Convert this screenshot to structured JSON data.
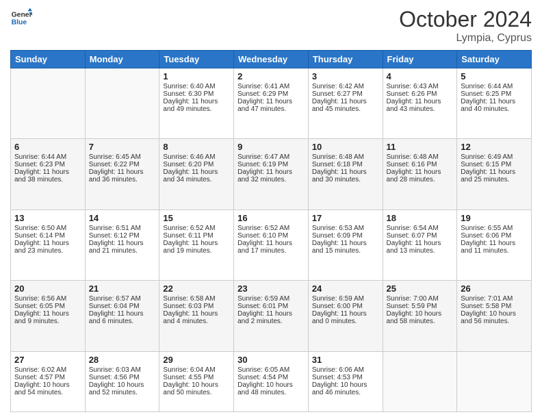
{
  "logo": {
    "line1": "General",
    "line2": "Blue"
  },
  "header": {
    "month": "October 2024",
    "location": "Lympia, Cyprus"
  },
  "weekdays": [
    "Sunday",
    "Monday",
    "Tuesday",
    "Wednesday",
    "Thursday",
    "Friday",
    "Saturday"
  ],
  "weeks": [
    [
      {
        "day": "",
        "sunrise": "",
        "sunset": "",
        "daylight": ""
      },
      {
        "day": "",
        "sunrise": "",
        "sunset": "",
        "daylight": ""
      },
      {
        "day": "1",
        "sunrise": "Sunrise: 6:40 AM",
        "sunset": "Sunset: 6:30 PM",
        "daylight": "Daylight: 11 hours and 49 minutes."
      },
      {
        "day": "2",
        "sunrise": "Sunrise: 6:41 AM",
        "sunset": "Sunset: 6:29 PM",
        "daylight": "Daylight: 11 hours and 47 minutes."
      },
      {
        "day": "3",
        "sunrise": "Sunrise: 6:42 AM",
        "sunset": "Sunset: 6:27 PM",
        "daylight": "Daylight: 11 hours and 45 minutes."
      },
      {
        "day": "4",
        "sunrise": "Sunrise: 6:43 AM",
        "sunset": "Sunset: 6:26 PM",
        "daylight": "Daylight: 11 hours and 43 minutes."
      },
      {
        "day": "5",
        "sunrise": "Sunrise: 6:44 AM",
        "sunset": "Sunset: 6:25 PM",
        "daylight": "Daylight: 11 hours and 40 minutes."
      }
    ],
    [
      {
        "day": "6",
        "sunrise": "Sunrise: 6:44 AM",
        "sunset": "Sunset: 6:23 PM",
        "daylight": "Daylight: 11 hours and 38 minutes."
      },
      {
        "day": "7",
        "sunrise": "Sunrise: 6:45 AM",
        "sunset": "Sunset: 6:22 PM",
        "daylight": "Daylight: 11 hours and 36 minutes."
      },
      {
        "day": "8",
        "sunrise": "Sunrise: 6:46 AM",
        "sunset": "Sunset: 6:20 PM",
        "daylight": "Daylight: 11 hours and 34 minutes."
      },
      {
        "day": "9",
        "sunrise": "Sunrise: 6:47 AM",
        "sunset": "Sunset: 6:19 PM",
        "daylight": "Daylight: 11 hours and 32 minutes."
      },
      {
        "day": "10",
        "sunrise": "Sunrise: 6:48 AM",
        "sunset": "Sunset: 6:18 PM",
        "daylight": "Daylight: 11 hours and 30 minutes."
      },
      {
        "day": "11",
        "sunrise": "Sunrise: 6:48 AM",
        "sunset": "Sunset: 6:16 PM",
        "daylight": "Daylight: 11 hours and 28 minutes."
      },
      {
        "day": "12",
        "sunrise": "Sunrise: 6:49 AM",
        "sunset": "Sunset: 6:15 PM",
        "daylight": "Daylight: 11 hours and 25 minutes."
      }
    ],
    [
      {
        "day": "13",
        "sunrise": "Sunrise: 6:50 AM",
        "sunset": "Sunset: 6:14 PM",
        "daylight": "Daylight: 11 hours and 23 minutes."
      },
      {
        "day": "14",
        "sunrise": "Sunrise: 6:51 AM",
        "sunset": "Sunset: 6:12 PM",
        "daylight": "Daylight: 11 hours and 21 minutes."
      },
      {
        "day": "15",
        "sunrise": "Sunrise: 6:52 AM",
        "sunset": "Sunset: 6:11 PM",
        "daylight": "Daylight: 11 hours and 19 minutes."
      },
      {
        "day": "16",
        "sunrise": "Sunrise: 6:52 AM",
        "sunset": "Sunset: 6:10 PM",
        "daylight": "Daylight: 11 hours and 17 minutes."
      },
      {
        "day": "17",
        "sunrise": "Sunrise: 6:53 AM",
        "sunset": "Sunset: 6:09 PM",
        "daylight": "Daylight: 11 hours and 15 minutes."
      },
      {
        "day": "18",
        "sunrise": "Sunrise: 6:54 AM",
        "sunset": "Sunset: 6:07 PM",
        "daylight": "Daylight: 11 hours and 13 minutes."
      },
      {
        "day": "19",
        "sunrise": "Sunrise: 6:55 AM",
        "sunset": "Sunset: 6:06 PM",
        "daylight": "Daylight: 11 hours and 11 minutes."
      }
    ],
    [
      {
        "day": "20",
        "sunrise": "Sunrise: 6:56 AM",
        "sunset": "Sunset: 6:05 PM",
        "daylight": "Daylight: 11 hours and 9 minutes."
      },
      {
        "day": "21",
        "sunrise": "Sunrise: 6:57 AM",
        "sunset": "Sunset: 6:04 PM",
        "daylight": "Daylight: 11 hours and 6 minutes."
      },
      {
        "day": "22",
        "sunrise": "Sunrise: 6:58 AM",
        "sunset": "Sunset: 6:03 PM",
        "daylight": "Daylight: 11 hours and 4 minutes."
      },
      {
        "day": "23",
        "sunrise": "Sunrise: 6:59 AM",
        "sunset": "Sunset: 6:01 PM",
        "daylight": "Daylight: 11 hours and 2 minutes."
      },
      {
        "day": "24",
        "sunrise": "Sunrise: 6:59 AM",
        "sunset": "Sunset: 6:00 PM",
        "daylight": "Daylight: 11 hours and 0 minutes."
      },
      {
        "day": "25",
        "sunrise": "Sunrise: 7:00 AM",
        "sunset": "Sunset: 5:59 PM",
        "daylight": "Daylight: 10 hours and 58 minutes."
      },
      {
        "day": "26",
        "sunrise": "Sunrise: 7:01 AM",
        "sunset": "Sunset: 5:58 PM",
        "daylight": "Daylight: 10 hours and 56 minutes."
      }
    ],
    [
      {
        "day": "27",
        "sunrise": "Sunrise: 6:02 AM",
        "sunset": "Sunset: 4:57 PM",
        "daylight": "Daylight: 10 hours and 54 minutes."
      },
      {
        "day": "28",
        "sunrise": "Sunrise: 6:03 AM",
        "sunset": "Sunset: 4:56 PM",
        "daylight": "Daylight: 10 hours and 52 minutes."
      },
      {
        "day": "29",
        "sunrise": "Sunrise: 6:04 AM",
        "sunset": "Sunset: 4:55 PM",
        "daylight": "Daylight: 10 hours and 50 minutes."
      },
      {
        "day": "30",
        "sunrise": "Sunrise: 6:05 AM",
        "sunset": "Sunset: 4:54 PM",
        "daylight": "Daylight: 10 hours and 48 minutes."
      },
      {
        "day": "31",
        "sunrise": "Sunrise: 6:06 AM",
        "sunset": "Sunset: 4:53 PM",
        "daylight": "Daylight: 10 hours and 46 minutes."
      },
      {
        "day": "",
        "sunrise": "",
        "sunset": "",
        "daylight": ""
      },
      {
        "day": "",
        "sunrise": "",
        "sunset": "",
        "daylight": ""
      }
    ]
  ]
}
